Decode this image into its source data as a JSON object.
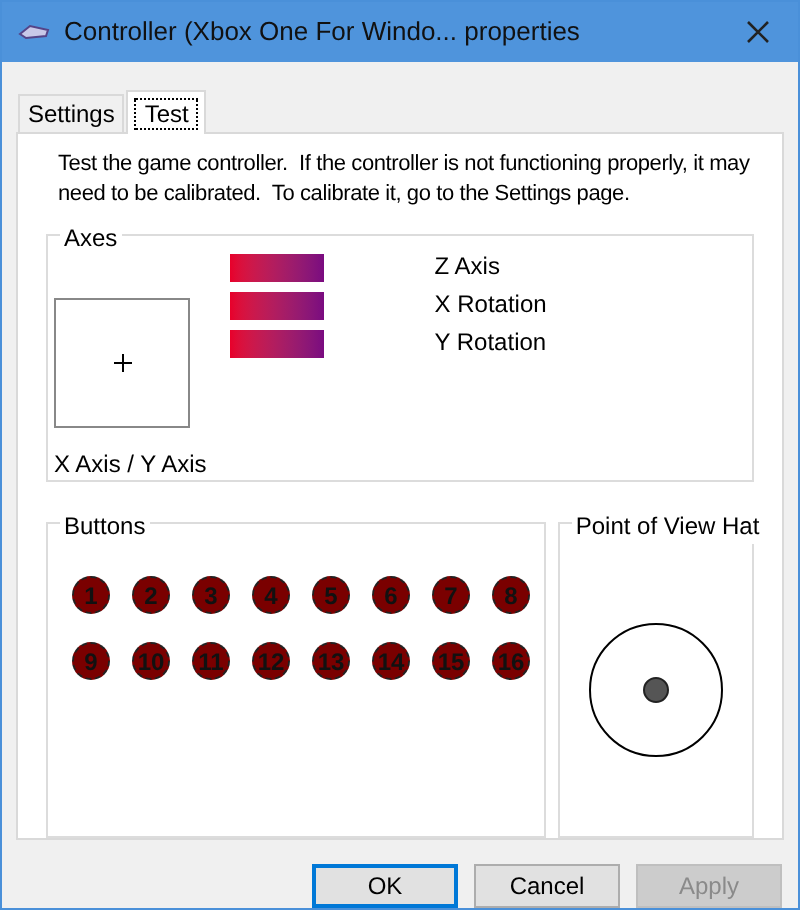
{
  "window": {
    "title": "Controller (Xbox One For Windo... properties"
  },
  "tabs": [
    {
      "label": "Settings",
      "selected": false
    },
    {
      "label": "Test",
      "selected": true
    }
  ],
  "description": "Test the game controller.  If the controller is not functioning properly, it may need to be calibrated.  To calibrate it, go to the Settings page.",
  "axes": {
    "title": "Axes",
    "xy_label": "X Axis / Y Axis",
    "bars": [
      {
        "label": "Z Axis"
      },
      {
        "label": "X Rotation"
      },
      {
        "label": "Y Rotation"
      }
    ]
  },
  "buttons": {
    "title": "Buttons",
    "items": [
      {
        "label": "1",
        "pressed": false
      },
      {
        "label": "2",
        "pressed": false
      },
      {
        "label": "3",
        "pressed": false
      },
      {
        "label": "4",
        "pressed": false
      },
      {
        "label": "5",
        "pressed": false
      },
      {
        "label": "6",
        "pressed": false
      },
      {
        "label": "7",
        "pressed": false
      },
      {
        "label": "8",
        "pressed": false
      },
      {
        "label": "9",
        "pressed": false
      },
      {
        "label": "10",
        "pressed": false
      },
      {
        "label": "11",
        "pressed": false
      },
      {
        "label": "12",
        "pressed": false
      },
      {
        "label": "13",
        "pressed": false
      },
      {
        "label": "14",
        "pressed": false
      },
      {
        "label": "15",
        "pressed": false
      },
      {
        "label": "16",
        "pressed": false
      }
    ]
  },
  "pov": {
    "title": "Point of View Hat"
  },
  "dialog_buttons": [
    {
      "label": "OK",
      "default": true,
      "disabled": false
    },
    {
      "label": "Cancel",
      "default": false,
      "disabled": false
    },
    {
      "label": "Apply",
      "default": false,
      "disabled": true
    }
  ]
}
